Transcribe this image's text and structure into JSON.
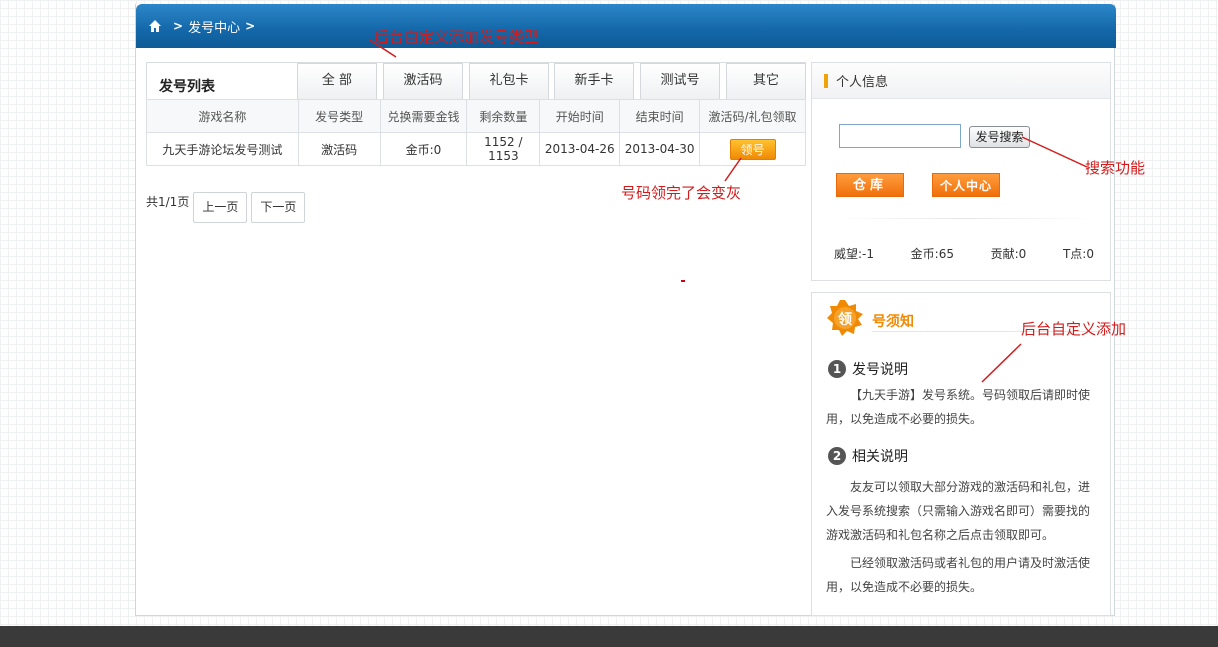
{
  "breadcrumb": {
    "current": "发号中心"
  },
  "list": {
    "title": "发号列表",
    "tabs": [
      "全 部",
      "激活码",
      "礼包卡",
      "新手卡",
      "测试号",
      "其它"
    ],
    "columns": [
      "游戏名称",
      "发号类型",
      "兑换需要金钱",
      "剩余数量",
      "开始时间",
      "结束时间",
      "激活码/礼包领取"
    ],
    "rows": [
      {
        "game": "九天手游论坛发号测试",
        "type": "激活码",
        "cost": "金币:0",
        "remaining": "1152 / 1153",
        "start": "2013-04-26",
        "end": "2013-04-30",
        "action": "领号"
      }
    ]
  },
  "pager": {
    "info": "共1/1页",
    "prev": "上一页",
    "next": "下一页"
  },
  "profile": {
    "title": "个人信息",
    "search_button": "发号搜索",
    "search_value": "",
    "warehouse_button": "仓库",
    "user_center_button": "个人中心",
    "stats": [
      "威望:-1",
      "金币:65",
      "贡献:0",
      "T点:0"
    ]
  },
  "notice": {
    "badge": "领",
    "title": "号须知",
    "sections": [
      {
        "num": "1",
        "heading": "发号说明",
        "paragraphs": [
          "【九天手游】发号系统。号码领取后请即时使用，以免造成不必要的损失。"
        ]
      },
      {
        "num": "2",
        "heading": "相关说明",
        "paragraphs": [
          "友友可以领取大部分游戏的激活码和礼包，进入发号系统搜索（只需输入游戏名即可）需要找的游戏激活码和礼包名称之后点击领取即可。",
          "已经领取激活码或者礼包的用户请及时激活使用，以免造成不必要的损失。"
        ]
      }
    ]
  },
  "annotations": {
    "tabs_note": "后台自定义添加发号类型",
    "button_note": "号码领完了会变灰",
    "search_note": "搜索功能",
    "notice_note": "后台自定义添加"
  },
  "colors": {
    "header_blue": "#1467a8",
    "accent_orange": "#f08a05",
    "annotation_red": "#d21c1c"
  }
}
